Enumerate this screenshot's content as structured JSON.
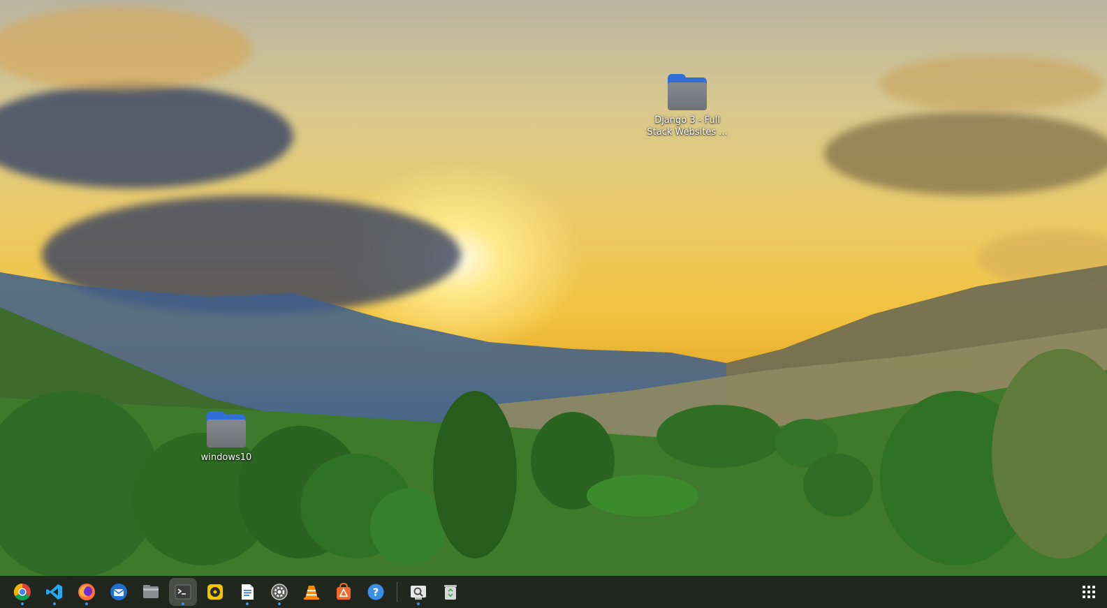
{
  "desktop": {
    "icons": [
      {
        "label": "Django 3 - Full\nStack Websites ...",
        "icon": "folder-icon"
      },
      {
        "label": "windows10",
        "icon": "folder-icon"
      }
    ]
  },
  "dock": {
    "apps": [
      {
        "name": "Google Chrome",
        "icon": "chrome-icon"
      },
      {
        "name": "Visual Studio Code",
        "icon": "vscode-icon"
      },
      {
        "name": "Firefox",
        "icon": "firefox-icon"
      },
      {
        "name": "Thunderbird",
        "icon": "thunderbird-icon"
      },
      {
        "name": "Files",
        "icon": "files-icon"
      },
      {
        "name": "Terminal",
        "icon": "terminal-icon",
        "active": true
      },
      {
        "name": "Rhythmbox",
        "icon": "rhythmbox-icon"
      },
      {
        "name": "LibreOffice Writer",
        "icon": "writer-icon"
      },
      {
        "name": "Settings",
        "icon": "settings-icon"
      },
      {
        "name": "VLC",
        "icon": "vlc-icon"
      },
      {
        "name": "Ubuntu Software",
        "icon": "software-icon"
      },
      {
        "name": "Help",
        "icon": "help-icon"
      },
      {
        "name": "Screenshot",
        "icon": "screenshot-icon"
      },
      {
        "name": "Trash",
        "icon": "trash-icon"
      }
    ],
    "show_apps": "show-applications-icon"
  },
  "colors": {
    "dock_bg": "#1c1c1c",
    "folder_blue": "#2f6fd6",
    "folder_gray": "#74777c",
    "running_dot": "#3d8ee8"
  }
}
